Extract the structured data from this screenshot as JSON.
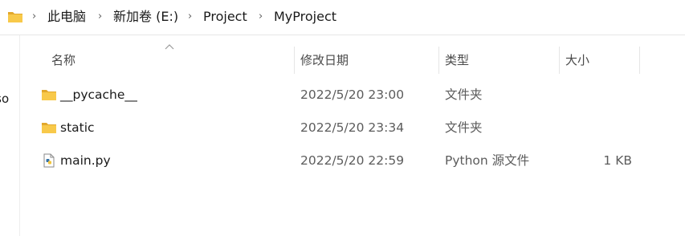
{
  "breadcrumb": {
    "items": [
      {
        "label": "此电脑"
      },
      {
        "label": "新加卷 (E:)"
      },
      {
        "label": "Project"
      },
      {
        "label": "MyProject"
      }
    ],
    "separator": "›"
  },
  "nav_pane": {
    "partial_text": "rso"
  },
  "columns": {
    "name": "名称",
    "date": "修改日期",
    "type": "类型",
    "size": "大小"
  },
  "files": [
    {
      "name": "__pycache__",
      "date": "2022/5/20 23:00",
      "type": "文件夹",
      "size": "",
      "icon": "folder-icon"
    },
    {
      "name": "static",
      "date": "2022/5/20 23:34",
      "type": "文件夹",
      "size": "",
      "icon": "folder-icon"
    },
    {
      "name": "main.py",
      "date": "2022/5/20 22:59",
      "type": "Python 源文件",
      "size": "1 KB",
      "icon": "python-file-icon"
    }
  ],
  "colors": {
    "folder_yellow": "#f8c94a",
    "folder_dark": "#e2a82c",
    "secondary_text": "#5c5c5c"
  }
}
